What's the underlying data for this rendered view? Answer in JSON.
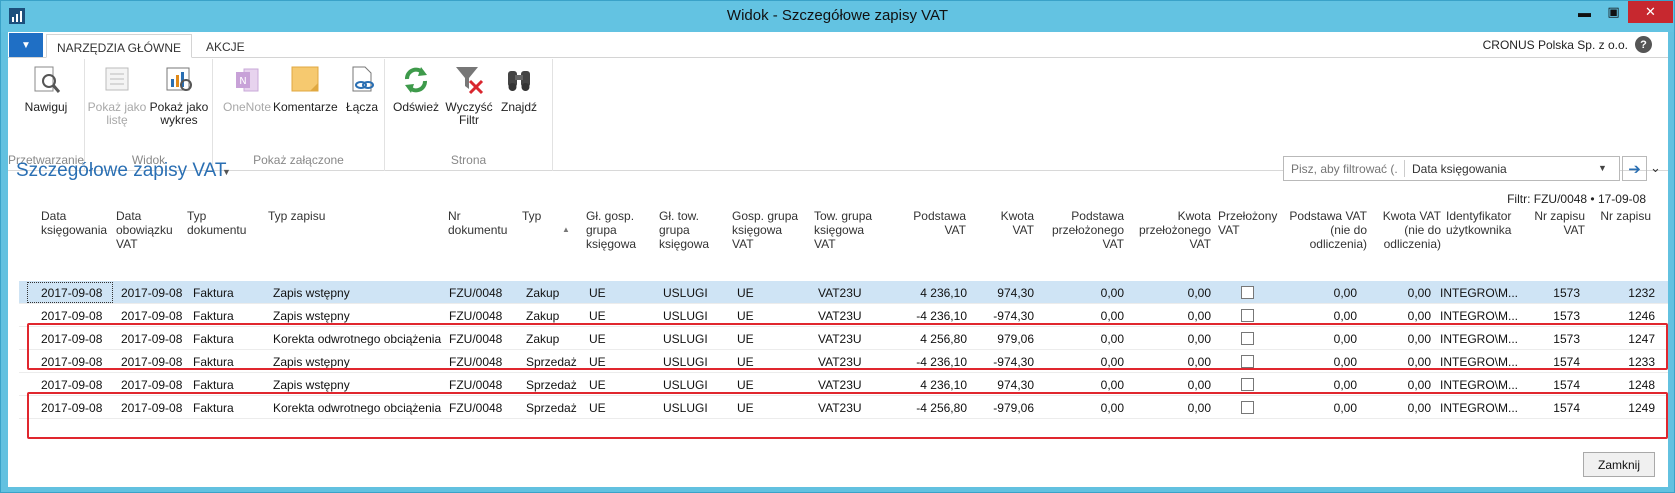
{
  "window": {
    "title": "Widok - Szczegółowe zapisy VAT",
    "minimize": "▬",
    "maximize": "▣",
    "close": "✕"
  },
  "ribbon": {
    "tabs": [
      "NARZĘDZIA GŁÓWNE",
      "AKCJE"
    ],
    "company": "CRONUS Polska Sp. z o.o.",
    "help": "?",
    "groups": [
      {
        "label": "Przetwarzanie",
        "buttons": [
          {
            "label": "Nawiguj",
            "icon": "navigate-icon",
            "enabled": true
          }
        ]
      },
      {
        "label": "Widok",
        "buttons": [
          {
            "label": "Pokaż jako listę",
            "icon": "list-view-icon",
            "enabled": false
          },
          {
            "label": "Pokaż jako wykres",
            "icon": "chart-view-icon",
            "enabled": true
          }
        ]
      },
      {
        "label": "Pokaż załączone",
        "buttons": [
          {
            "label": "OneNote",
            "icon": "onenote-icon",
            "enabled": false
          },
          {
            "label": "Komentarze",
            "icon": "comments-icon",
            "enabled": true
          },
          {
            "label": "Łącza",
            "icon": "links-icon",
            "enabled": true
          }
        ]
      },
      {
        "label": "Strona",
        "buttons": [
          {
            "label": "Odśwież",
            "icon": "refresh-icon",
            "enabled": true
          },
          {
            "label": "Wyczyść Filtr",
            "icon": "clear-filter-icon",
            "enabled": true
          },
          {
            "label": "Znajdź",
            "icon": "find-icon",
            "enabled": true
          }
        ]
      }
    ]
  },
  "page": {
    "title": "Szczegółowe zapisy VAT",
    "search_placeholder": "Pisz, aby filtrować (...",
    "search_field": "Data księgowania",
    "filter": "Filtr: FZU/0048 • 17-09-08",
    "close_button": "Zamknij"
  },
  "table": {
    "columns": [
      "Data księgowania",
      "Data obowiązku VAT",
      "Typ dokumentu",
      "Typ zapisu",
      "Nr dokumentu",
      "Typ",
      "Gł. gosp. grupa księgowa",
      "Gł. tow. grupa księgowa",
      "Gosp. grupa księgowa VAT",
      "Tow. grupa księgowa VAT",
      "Podstawa VAT",
      "Kwota VAT",
      "Podstawa przełożonego VAT",
      "Kwota przełożonego VAT",
      "Przełożony VAT",
      "Podstawa VAT (nie do odliczenia)",
      "Kwota VAT (nie do odliczenia)",
      "Identyfikator użytkownika",
      "Nr zapisu VAT",
      "Nr zapisu"
    ],
    "rows": [
      {
        "posting_date": "2017-09-08",
        "vat_date": "2017-09-08",
        "doc_type": "Faktura",
        "entry_type": "Zapis wstępny",
        "doc_no": "FZU/0048",
        "type": "Zakup",
        "gen_bus": "UE",
        "gen_prod": "USLUGI",
        "vat_bus": "UE",
        "vat_prod": "VAT23U",
        "base": "4 236,10",
        "amount": "974,30",
        "unreal_base": "0,00",
        "unreal_amount": "0,00",
        "reversed": false,
        "nd_base": "0,00",
        "nd_amount": "0,00",
        "user": "INTEGRO\\M...",
        "vat_entry_no": "1573",
        "entry_no": "1232"
      },
      {
        "posting_date": "2017-09-08",
        "vat_date": "2017-09-08",
        "doc_type": "Faktura",
        "entry_type": "Zapis wstępny",
        "doc_no": "FZU/0048",
        "type": "Zakup",
        "gen_bus": "UE",
        "gen_prod": "USLUGI",
        "vat_bus": "UE",
        "vat_prod": "VAT23U",
        "base": "-4 236,10",
        "amount": "-974,30",
        "unreal_base": "0,00",
        "unreal_amount": "0,00",
        "reversed": false,
        "nd_base": "0,00",
        "nd_amount": "0,00",
        "user": "INTEGRO\\M...",
        "vat_entry_no": "1573",
        "entry_no": "1246"
      },
      {
        "posting_date": "2017-09-08",
        "vat_date": "2017-09-08",
        "doc_type": "Faktura",
        "entry_type": "Korekta odwrotnego obciążenia",
        "doc_no": "FZU/0048",
        "type": "Zakup",
        "gen_bus": "UE",
        "gen_prod": "USLUGI",
        "vat_bus": "UE",
        "vat_prod": "VAT23U",
        "base": "4 256,80",
        "amount": "979,06",
        "unreal_base": "0,00",
        "unreal_amount": "0,00",
        "reversed": false,
        "nd_base": "0,00",
        "nd_amount": "0,00",
        "user": "INTEGRO\\M...",
        "vat_entry_no": "1573",
        "entry_no": "1247"
      },
      {
        "posting_date": "2017-09-08",
        "vat_date": "2017-09-08",
        "doc_type": "Faktura",
        "entry_type": "Zapis wstępny",
        "doc_no": "FZU/0048",
        "type": "Sprzedaż",
        "gen_bus": "UE",
        "gen_prod": "USLUGI",
        "vat_bus": "UE",
        "vat_prod": "VAT23U",
        "base": "-4 236,10",
        "amount": "-974,30",
        "unreal_base": "0,00",
        "unreal_amount": "0,00",
        "reversed": false,
        "nd_base": "0,00",
        "nd_amount": "0,00",
        "user": "INTEGRO\\M...",
        "vat_entry_no": "1574",
        "entry_no": "1233"
      },
      {
        "posting_date": "2017-09-08",
        "vat_date": "2017-09-08",
        "doc_type": "Faktura",
        "entry_type": "Zapis wstępny",
        "doc_no": "FZU/0048",
        "type": "Sprzedaż",
        "gen_bus": "UE",
        "gen_prod": "USLUGI",
        "vat_bus": "UE",
        "vat_prod": "VAT23U",
        "base": "4 236,10",
        "amount": "974,30",
        "unreal_base": "0,00",
        "unreal_amount": "0,00",
        "reversed": false,
        "nd_base": "0,00",
        "nd_amount": "0,00",
        "user": "INTEGRO\\M...",
        "vat_entry_no": "1574",
        "entry_no": "1248"
      },
      {
        "posting_date": "2017-09-08",
        "vat_date": "2017-09-08",
        "doc_type": "Faktura",
        "entry_type": "Korekta odwrotnego obciążenia",
        "doc_no": "FZU/0048",
        "type": "Sprzedaż",
        "gen_bus": "UE",
        "gen_prod": "USLUGI",
        "vat_bus": "UE",
        "vat_prod": "VAT23U",
        "base": "-4 256,80",
        "amount": "-979,06",
        "unreal_base": "0,00",
        "unreal_amount": "0,00",
        "reversed": false,
        "nd_base": "0,00",
        "nd_amount": "0,00",
        "user": "INTEGRO\\M...",
        "vat_entry_no": "1574",
        "entry_no": "1249"
      }
    ]
  },
  "colors": {
    "titlebar": "#63c3e2",
    "accent": "#2a6fb3",
    "selected_row": "#cfe4f5",
    "highlight_box": "#e0262e"
  }
}
